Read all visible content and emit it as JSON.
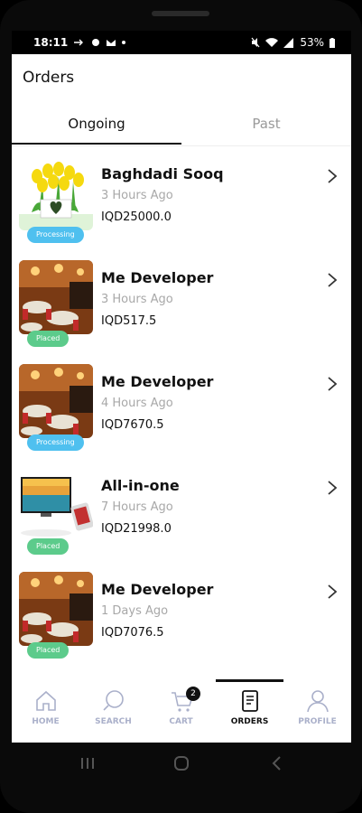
{
  "statusbar": {
    "time": "18:11",
    "battery": "53%"
  },
  "page": {
    "title": "Orders"
  },
  "tabs": [
    {
      "label": "Ongoing"
    },
    {
      "label": "Past"
    }
  ],
  "orders": [
    {
      "name": "Baghdadi Sooq",
      "time": "3 Hours Ago",
      "price": "IQD25000.0",
      "status": "Processing"
    },
    {
      "name": "Me Developer",
      "time": "3 Hours Ago",
      "price": "IQD517.5",
      "status": "Placed"
    },
    {
      "name": "Me Developer",
      "time": "4 Hours Ago",
      "price": "IQD7670.5",
      "status": "Processing"
    },
    {
      "name": "All-in-one",
      "time": "7 Hours Ago",
      "price": "IQD21998.0",
      "status": "Placed"
    },
    {
      "name": "Me Developer",
      "time": "1 Days Ago",
      "price": "IQD7076.5",
      "status": "Placed"
    }
  ],
  "nav": {
    "home": "HOME",
    "search": "SEARCH",
    "cart": "CART",
    "cart_count": "2",
    "orders": "ORDERS",
    "profile": "PROFILE"
  },
  "colors": {
    "processing": "#4fc0ef",
    "placed": "#5ccb8b",
    "inactive_nav": "#aab0ca"
  }
}
